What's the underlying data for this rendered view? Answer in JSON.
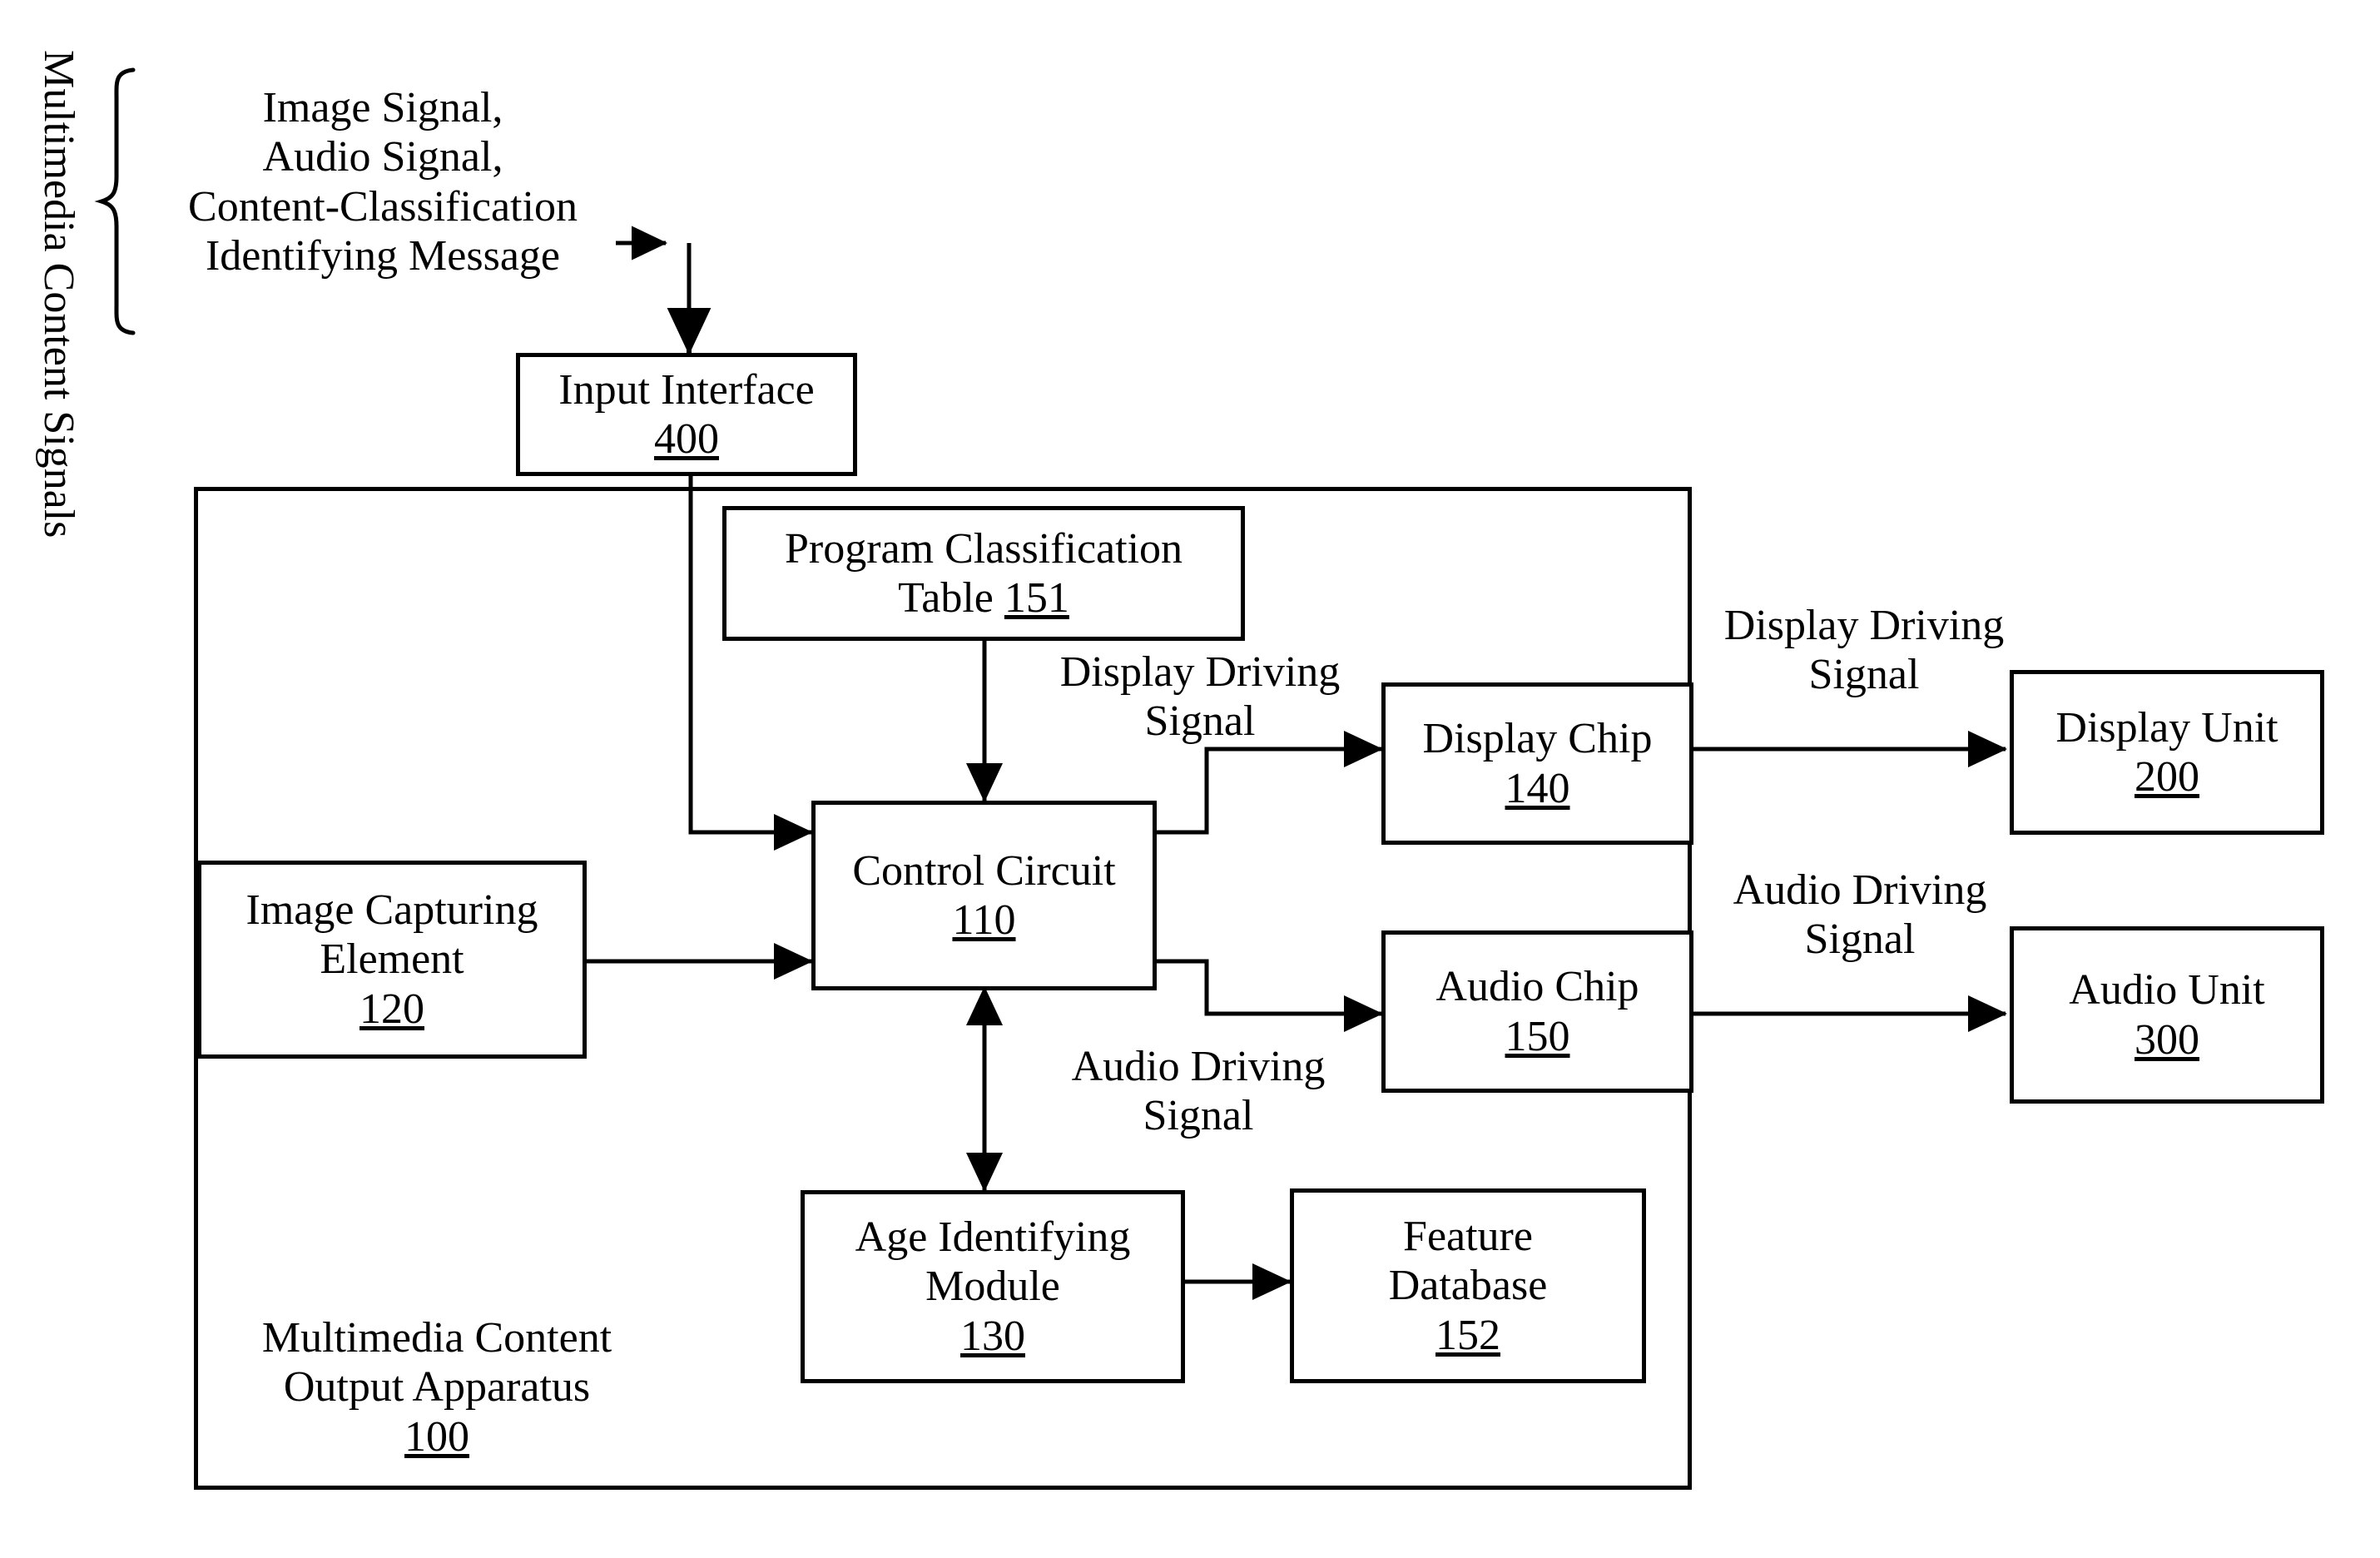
{
  "figure": {
    "type": "patent-block-diagram",
    "vertical_caption": "Multimedia Content Signals",
    "input_signals": {
      "line1": "Image Signal,",
      "line2": "Audio Signal,",
      "line3": "Content-Classification",
      "line4": "Identifying Message"
    },
    "apparatus_caption": {
      "line1": "Multimedia Content",
      "line2": "Output Apparatus",
      "number": "100"
    },
    "blocks": [
      {
        "id": "input-interface",
        "title_lines": [
          "Input Interface"
        ],
        "number": "400"
      },
      {
        "id": "program-classification-table",
        "title_lines": [
          "Program Classification",
          "Table"
        ],
        "number": "151",
        "number_inline": true
      },
      {
        "id": "control-circuit",
        "title_lines": [
          "Control Circuit"
        ],
        "number": "110"
      },
      {
        "id": "image-capturing-element",
        "title_lines": [
          "Image Capturing",
          "Element"
        ],
        "number": "120"
      },
      {
        "id": "display-chip",
        "title_lines": [
          "Display Chip"
        ],
        "number": "140"
      },
      {
        "id": "audio-chip",
        "title_lines": [
          "Audio Chip"
        ],
        "number": "150"
      },
      {
        "id": "display-unit",
        "title_lines": [
          "Display Unit"
        ],
        "number": "200"
      },
      {
        "id": "audio-unit",
        "title_lines": [
          "Audio Unit"
        ],
        "number": "300"
      },
      {
        "id": "age-identifying-module",
        "title_lines": [
          "Age Identifying",
          "Module"
        ],
        "number": "130"
      },
      {
        "id": "feature-database",
        "title_lines": [
          "Feature",
          "Database"
        ],
        "number": "152"
      }
    ],
    "signal_labels": {
      "display_driving_inner": {
        "line1": "Display Driving",
        "line2": "Signal"
      },
      "display_driving_outer": {
        "line1": "Display Driving",
        "line2": "Signal"
      },
      "audio_driving_inner": {
        "line1": "Audio Driving",
        "line2": "Signal"
      },
      "audio_driving_outer": {
        "line1": "Audio Driving",
        "line2": "Signal"
      }
    },
    "colors": {
      "line": "#000000",
      "background": "#ffffff",
      "text": "#000000"
    }
  }
}
